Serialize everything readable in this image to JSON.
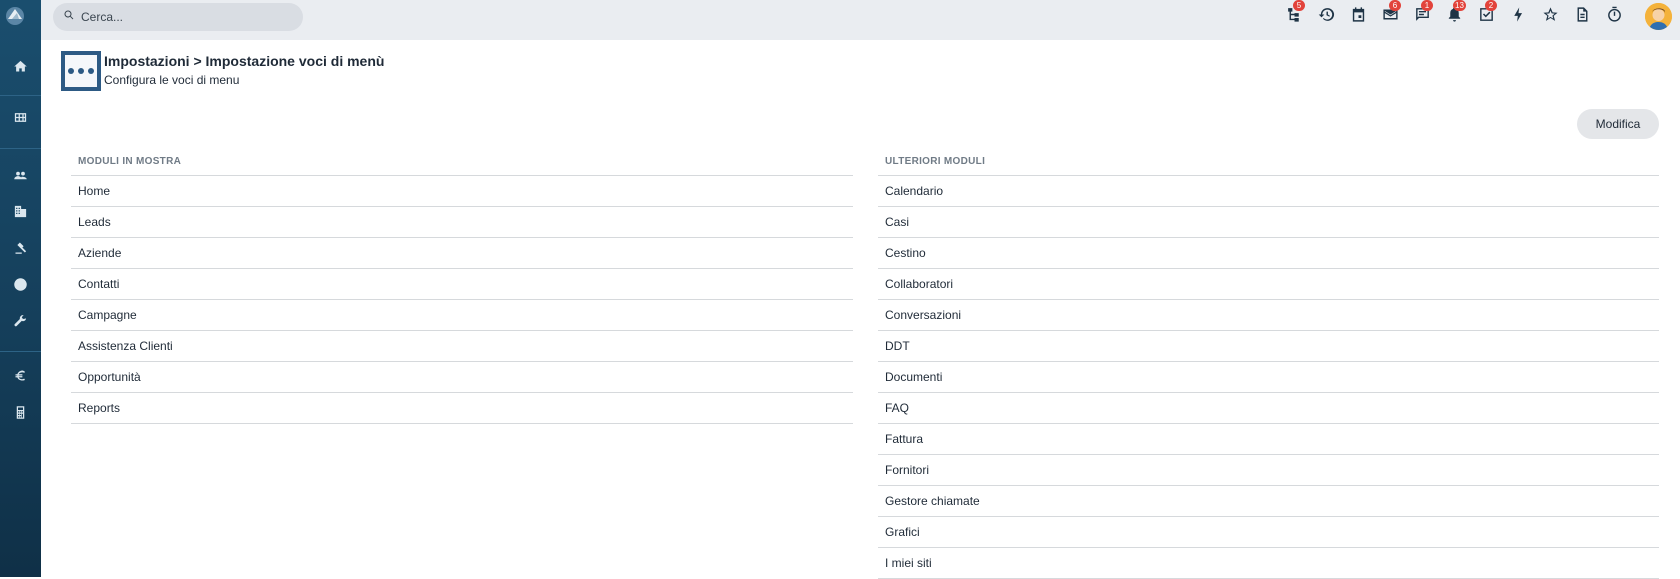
{
  "search": {
    "placeholder": "Cerca..."
  },
  "topbar": {
    "icons": [
      {
        "name": "hierarchy-icon",
        "badge": "5"
      },
      {
        "name": "history-icon",
        "badge": ""
      },
      {
        "name": "calendar-icon",
        "badge": ""
      },
      {
        "name": "mail-icon",
        "badge": "6"
      },
      {
        "name": "chat-icon",
        "badge": "1"
      },
      {
        "name": "bell-icon",
        "badge": "13"
      },
      {
        "name": "tasks-icon",
        "badge": "2"
      },
      {
        "name": "lightning-icon",
        "badge": ""
      },
      {
        "name": "star-icon",
        "badge": ""
      },
      {
        "name": "document-icon",
        "badge": ""
      },
      {
        "name": "timer-icon",
        "badge": ""
      }
    ]
  },
  "sidebar": {
    "items": [
      "home-icon",
      "grid-icon",
      "users-icon",
      "building-icon",
      "gavel-icon",
      "globe-icon",
      "wrench-icon",
      "euro-icon",
      "calculator-icon"
    ]
  },
  "header": {
    "title": "Impostazioni > Impostazione voci di menù",
    "subtitle": "Configura le voci di menu"
  },
  "actions": {
    "edit_label": "Modifica"
  },
  "left_list": {
    "title": "MODULI IN MOSTRA",
    "items": [
      "Home",
      "Leads",
      "Aziende",
      "Contatti",
      "Campagne",
      "Assistenza Clienti",
      "Opportunità",
      "Reports"
    ]
  },
  "right_list": {
    "title": "ULTERIORI MODULI",
    "items": [
      "Calendario",
      "Casi",
      "Cestino",
      "Collaboratori",
      "Conversazioni",
      "DDT",
      "Documenti",
      "FAQ",
      "Fattura",
      "Fornitori",
      "Gestore chiamate",
      "Grafici",
      "I miei siti"
    ]
  },
  "colors": {
    "sidebar": "#1a4e6e",
    "accent": "#2d5a84",
    "badge": "#e2433b"
  }
}
